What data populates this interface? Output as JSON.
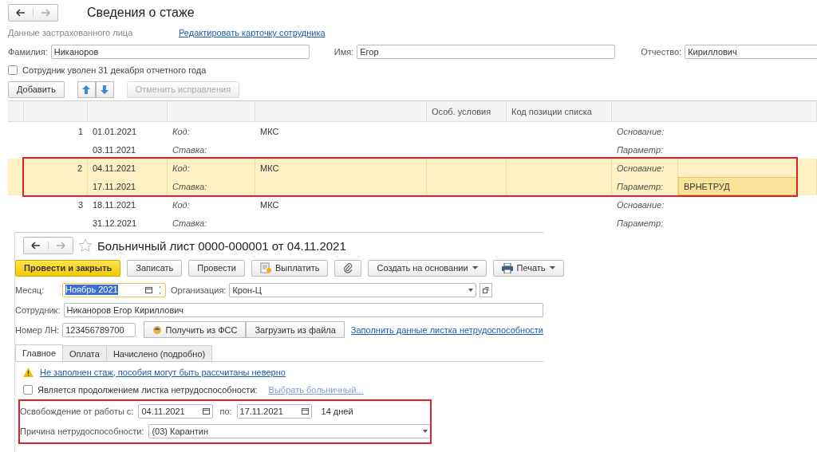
{
  "header": {
    "title": "Сведения о стаже"
  },
  "insured": {
    "label": "Данные застрахованного лица",
    "edit_link": "Редактировать карточку сотрудника"
  },
  "name_fields": [
    {
      "label": "Фамилия:",
      "value": "Никаноров"
    },
    {
      "label": "Имя:",
      "value": "Егор"
    },
    {
      "label": "Отчество:",
      "value": "Кириллович"
    }
  ],
  "dismissed": {
    "label": "Сотрудник уволен 31 декабря отчетного года",
    "checked": false
  },
  "toolbar": {
    "add": "Добавить",
    "cancel": {
      "label": "Отменить исправления",
      "disabled": true
    }
  },
  "table": {
    "columns": [
      "Особ. условия",
      "Код позиции списка"
    ],
    "rows": [
      {
        "number": "1",
        "start": "01.01.2021",
        "end": "03.11.2021",
        "code_label": "Код:",
        "code": "МКС",
        "rate_label": "Ставка:",
        "basis_label": "Основание:",
        "param_label": "Параметр:",
        "selected": false
      },
      {
        "number": "2",
        "start": "04.11.2021",
        "end": "17.11.2021",
        "code_label": "Код:",
        "code": "МКС",
        "rate_label": "Ставка:",
        "basis_label": "Основание:",
        "param_label": "Параметр:",
        "param": "ВРНЕТРУД",
        "selected": true
      },
      {
        "number": "3",
        "start": "18.11.2021",
        "end": "31.12.2021",
        "code_label": "Код:",
        "code": "МКС",
        "rate_label": "Ставка:",
        "basis_label": "Основание:",
        "param_label": "Параметр:",
        "selected": false
      }
    ]
  },
  "document": {
    "title": "Больничный лист 0000-000001 от 04.11.2021",
    "buttons": [
      {
        "kind": "primary",
        "label": "Провести и закрыть"
      },
      {
        "kind": "plain",
        "label": "Записать"
      },
      {
        "kind": "plain",
        "label": "Провести"
      },
      {
        "kind": "pay",
        "label": "Выплатить"
      },
      {
        "kind": "clip"
      },
      {
        "kind": "menu",
        "label": "Создать на основании"
      },
      {
        "kind": "print",
        "label": "Печать"
      }
    ],
    "month": {
      "label": "Месяц:",
      "value": "Ноябрь 2021"
    },
    "organization": {
      "label": "Организация:",
      "value": "Крон-Ц"
    },
    "employee": {
      "label": "Сотрудник:",
      "value": "Никаноров Егор Кириллович"
    },
    "sick_note": {
      "label": "Номер ЛН:",
      "value": "123456789700",
      "fss_button": "Получить из ФСС",
      "file_button": "Загрузить из файла",
      "fill_link": "Заполнить данные листка нетрудоспособности"
    },
    "tabs": [
      {
        "label": "Главное",
        "selected": true
      },
      {
        "label": "Оплата",
        "selected": false
      },
      {
        "label": "Начислено (подробно)",
        "selected": false
      }
    ],
    "warning": "Не заполнен стаж, пособия могут быть рассчитаны неверно",
    "continuation": {
      "label": "Является продолжением листка нетрудоспособности:",
      "checked": false,
      "link": "Выбрать больничный..."
    },
    "release": {
      "label": "Освобождение от работы с:",
      "from": "04.11.2021",
      "to_label": "по:",
      "to": "17.11.2021",
      "days": "14 дней"
    },
    "reason": {
      "label": "Причина нетрудоспособности:",
      "value": "(03) Карантин"
    }
  }
}
